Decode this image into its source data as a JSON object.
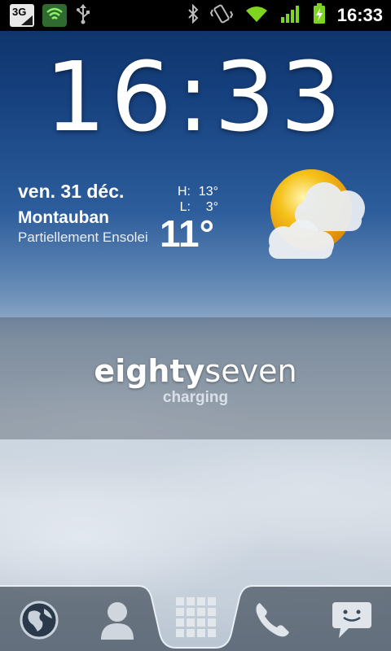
{
  "status_bar": {
    "network_type": "3G",
    "time": "16:33",
    "icons": [
      "3g-data-icon",
      "shield-icon",
      "usb-icon",
      "bluetooth-icon",
      "vibrate-icon",
      "wifi-icon",
      "signal-icon",
      "battery-charging-icon"
    ]
  },
  "clock": {
    "time": "16:33"
  },
  "weather": {
    "date": "ven. 31 déc.",
    "city": "Montauban",
    "condition": "Partiellement Ensoleillé",
    "high_label": "H:",
    "high": "13°",
    "low_label": "L:",
    "low": "3°",
    "temperature": "11°",
    "icon": "partly-cloudy-icon"
  },
  "battery": {
    "bold_part": "eighty",
    "light_part": "seven",
    "status": "charging"
  },
  "dock": {
    "items": [
      "browser-icon",
      "contacts-icon",
      "app-drawer-icon",
      "phone-icon",
      "messaging-icon"
    ]
  },
  "colors": {
    "status_bar_bg": "#000000",
    "signal_green": "#7fd321",
    "sun_yellow": "#f5c21b",
    "sky_top": "#0d2f63"
  }
}
